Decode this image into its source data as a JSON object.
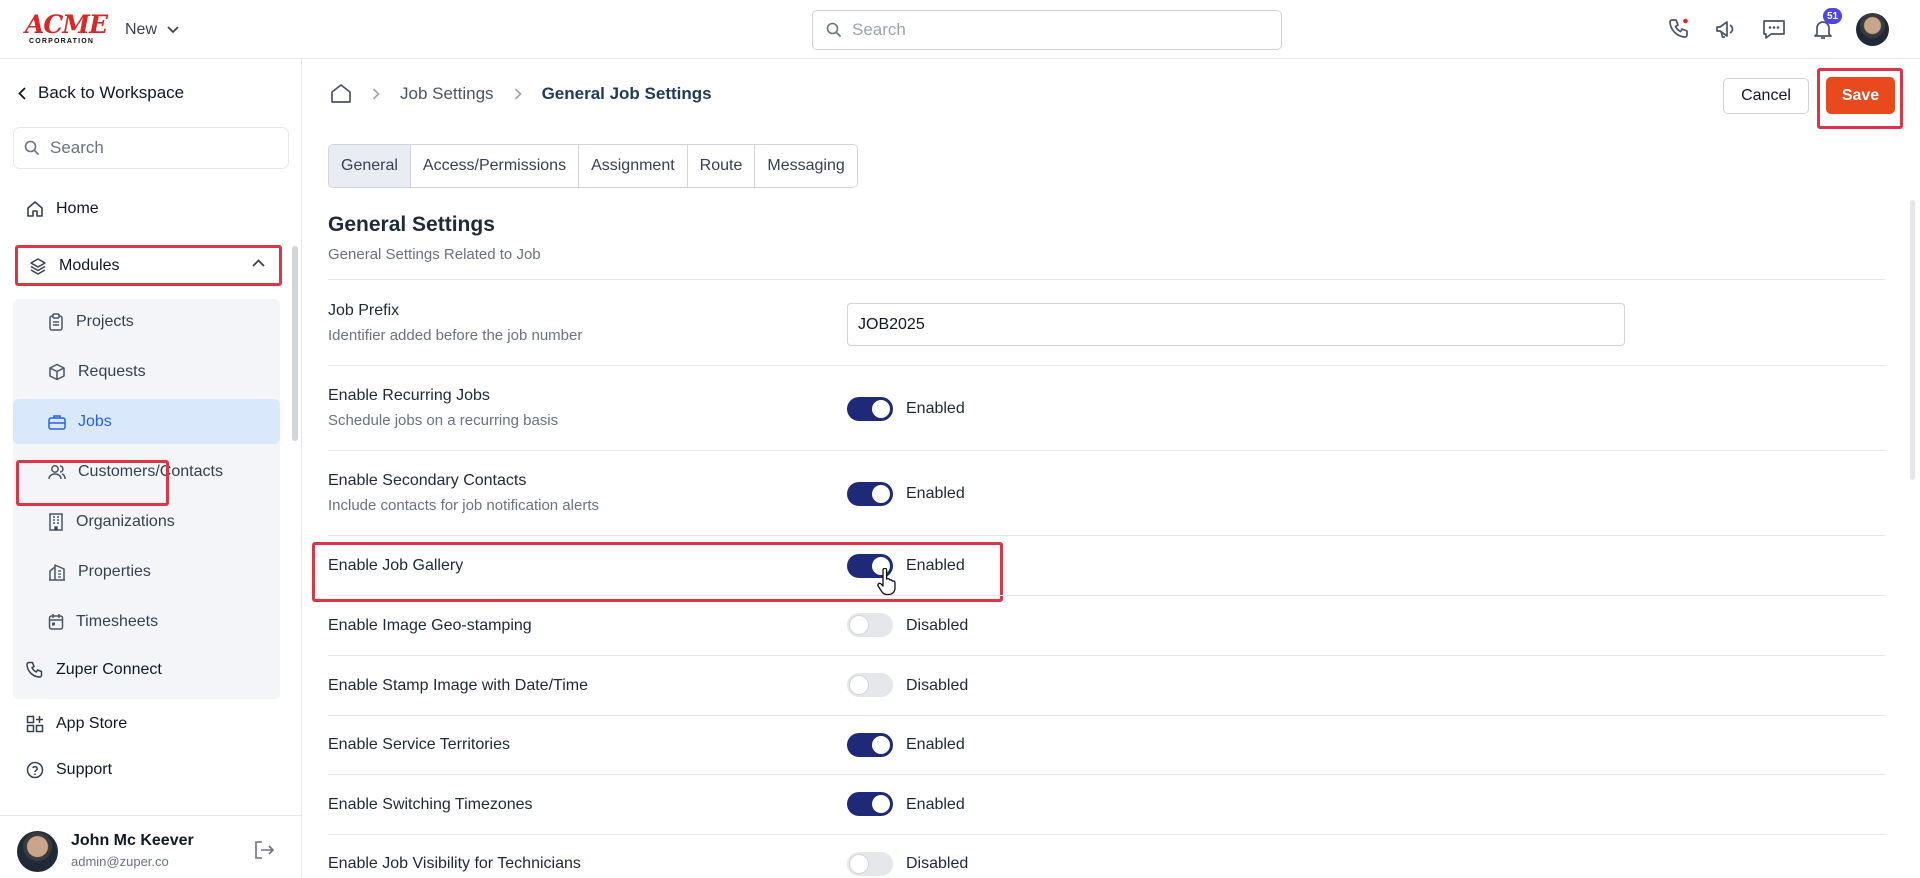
{
  "app": {
    "logo_main": "ACME",
    "logo_sub": "CORPORATION",
    "new_label": "New",
    "search_placeholder": "Search",
    "notification_count": "51"
  },
  "sidebar": {
    "back_label": "Back to Workspace",
    "search_placeholder": "Search",
    "home_label": "Home",
    "modules_label": "Modules",
    "modules": [
      {
        "label": "Projects",
        "icon": "clipboard-icon"
      },
      {
        "label": "Requests",
        "icon": "package-icon"
      },
      {
        "label": "Jobs",
        "icon": "briefcase-icon",
        "active": true
      },
      {
        "label": "Customers/Contacts",
        "icon": "users-icon"
      },
      {
        "label": "Organizations",
        "icon": "building-icon"
      },
      {
        "label": "Properties",
        "icon": "properties-icon"
      },
      {
        "label": "Timesheets",
        "icon": "calendar-icon"
      }
    ],
    "zuper_connect_label": "Zuper Connect",
    "app_store_label": "App Store",
    "support_label": "Support",
    "user": {
      "name": "John Mc Keever",
      "email": "admin@zuper.co"
    }
  },
  "header": {
    "breadcrumb": [
      "Job Settings",
      "General Job Settings"
    ],
    "cancel_label": "Cancel",
    "save_label": "Save"
  },
  "tabs": [
    {
      "label": "General",
      "active": true
    },
    {
      "label": "Access/Permissions"
    },
    {
      "label": "Assignment"
    },
    {
      "label": "Route"
    },
    {
      "label": "Messaging"
    }
  ],
  "section": {
    "title": "General Settings",
    "subtitle": "General Settings Related to Job"
  },
  "settings": {
    "prefix": {
      "label": "Job Prefix",
      "desc": "Identifier added before the job number",
      "value": "JOB2025"
    },
    "rows": [
      {
        "label": "Enable Recurring Jobs",
        "desc": "Schedule jobs on a recurring basis",
        "enabled": true,
        "state": "Enabled"
      },
      {
        "label": "Enable Secondary Contacts",
        "desc": "Include contacts for job notification alerts",
        "enabled": true,
        "state": "Enabled"
      },
      {
        "label": "Enable Job Gallery",
        "enabled": true,
        "state": "Enabled"
      },
      {
        "label": "Enable Image Geo-stamping",
        "enabled": false,
        "state": "Disabled"
      },
      {
        "label": "Enable Stamp Image with Date/Time",
        "enabled": false,
        "state": "Disabled"
      },
      {
        "label": "Enable Service Territories",
        "enabled": true,
        "state": "Enabled"
      },
      {
        "label": "Enable Switching Timezones",
        "enabled": true,
        "state": "Enabled"
      },
      {
        "label": "Enable Job Visibility for Technicians",
        "enabled": false,
        "state": "Disabled"
      }
    ]
  },
  "colors": {
    "accent": "#1e2a78",
    "save": "#e8491d",
    "highlight": "#dc3545",
    "brand": "#dc2626"
  }
}
